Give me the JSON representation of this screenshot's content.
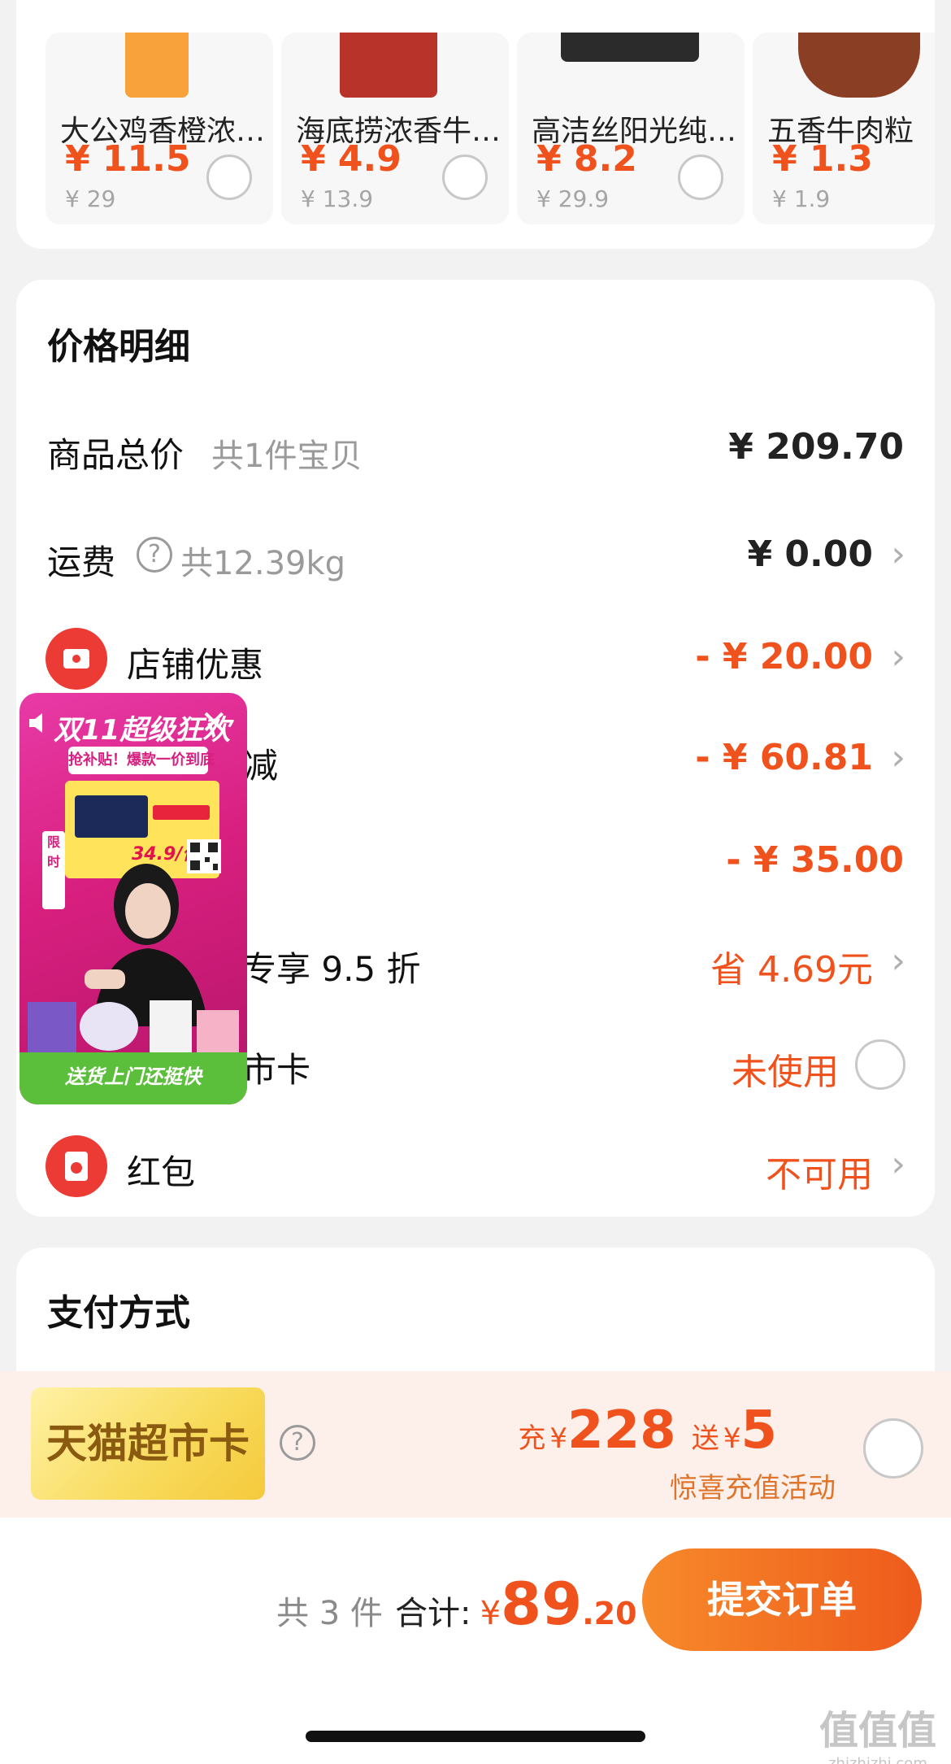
{
  "products": [
    {
      "name": "大公鸡香橙浓…",
      "price": "¥ 11.5",
      "original_price": "¥ 29"
    },
    {
      "name": "海底捞浓香牛…",
      "price": "¥ 4.9",
      "original_price": "¥ 13.9"
    },
    {
      "name": "高洁丝阳光纯…",
      "price": "¥ 8.2",
      "original_price": "¥ 29.9"
    },
    {
      "name": "五香牛肉粒",
      "price": "¥ 1.3",
      "original_price": "¥ 1.9"
    }
  ],
  "price_detail": {
    "title": "价格明细",
    "goods_total": {
      "label": "商品总价",
      "sub": "共1件宝贝",
      "value": "¥ 209.70"
    },
    "shipping": {
      "label": "运费",
      "sub": "共12.39kg",
      "value": "¥ 0.00"
    },
    "store_discount": {
      "label": "店铺优惠",
      "value": "- ¥ 20.00"
    },
    "row_reduce": {
      "label": "减",
      "value": "- ¥ 60.81"
    },
    "row_3": {
      "value": "- ¥ 35.00"
    },
    "row_member": {
      "label": "专享 9.5 折",
      "value": "省 4.69元"
    },
    "row_card": {
      "label": "市卡",
      "value": "未使用"
    },
    "red_packet": {
      "label": "红包",
      "value": "不可用"
    }
  },
  "live_video": {
    "title": "双11超级狂欢",
    "banner": "抢补贴！爆款一价到底",
    "price": "34.9/件",
    "tag": "限时",
    "bottom": "送货上门还挺快"
  },
  "payment": {
    "title": "支付方式",
    "tmall_card": {
      "label": "天猫超市卡",
      "recharge_prefix": "充",
      "recharge_currency": "¥",
      "recharge_amount": "228",
      "bonus_prefix": "送",
      "bonus_currency": "¥",
      "bonus_amount": "5",
      "activity": "惊喜充值活动"
    }
  },
  "bottom_bar": {
    "count": "共 3 件",
    "total_label": "合计:",
    "currency": "¥",
    "amount_int": "89",
    "amount_dec": ".20",
    "submit": "提交订单"
  },
  "watermark": {
    "main": "值值值",
    "url": "zhizhizhi.com"
  },
  "colors": {
    "accent": "#f0521e",
    "button": "#ee5a1c",
    "card_bg": "#ffffff",
    "page_bg": "#f2f2f2"
  }
}
